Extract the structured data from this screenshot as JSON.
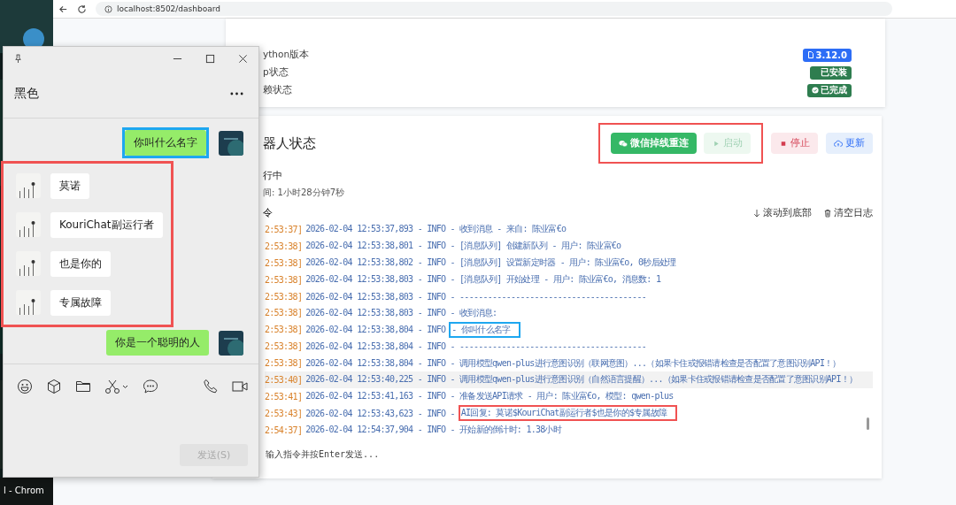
{
  "desktop": {
    "taskbar_label": "l - Chrom"
  },
  "browser": {
    "address": "localhost:8502/dashboard"
  },
  "env_card": {
    "rows": [
      {
        "label": "ython版本",
        "badge": "3.12.0",
        "kind": "version"
      },
      {
        "label": "p状态",
        "badge": "已安装",
        "kind": "installed"
      },
      {
        "label": "赖状态",
        "badge": "已完成",
        "kind": "done"
      }
    ]
  },
  "bot_card": {
    "title": "器人状态",
    "status": "行中",
    "uptime": "间: 1小时28分钟7秒",
    "button_groups": [
      {
        "annotation": {
          "color": "#f05252"
        },
        "buttons": [
          {
            "label": "微信掉线重连",
            "kind": "reconnect",
            "disabled": false
          },
          {
            "label": "启动",
            "kind": "start",
            "disabled": true
          }
        ]
      },
      {
        "buttons": [
          {
            "label": "停止",
            "kind": "stop",
            "disabled": false
          },
          {
            "label": "更新",
            "kind": "update",
            "disabled": false
          }
        ]
      }
    ],
    "log_title": "令",
    "log_actions": [
      {
        "label": "滚动到底部",
        "kind": "scroll"
      },
      {
        "label": "清空日志",
        "kind": "clear"
      }
    ],
    "log_lines": [
      {
        "time": "2:53:37]",
        "text": "2026-02-04 12:53:37,893 - INFO - 收到消息 - 来自: 陈业富€o",
        "hovered": false
      },
      {
        "time": "2:53:38]",
        "text": "2026-02-04 12:53:38,801 - INFO - [消息队列] 创建新队列 - 用户: 陈业富€o",
        "hovered": false
      },
      {
        "time": "2:53:38]",
        "text": "2026-02-04 12:53:38,802 - INFO - [消息队列] 设置新定时器 - 用户: 陈业富€o, 0秒后处理",
        "hovered": false
      },
      {
        "time": "2:53:38]",
        "text": "2026-02-04 12:53:38,803 - INFO - [消息队列] 开始处理 - 用户: 陈业富€o, 消息数: 1",
        "hovered": false
      },
      {
        "time": "2:53:38]",
        "text": "2026-02-04 12:53:38,803 - INFO - ----------------------------------------",
        "hovered": false
      },
      {
        "time": "2:53:38]",
        "text": "2026-02-04 12:53:38,803 - INFO - 收到消息:",
        "hovered": false
      },
      {
        "time": "2:53:38]",
        "text": "2026-02-04 12:53:38,804 - INFO",
        "note": {
          "text": "- 你叫什么名字",
          "color": "#1ea7f0"
        },
        "hovered": false
      },
      {
        "time": "2:53:38]",
        "text": "2026-02-04 12:53:38,804 - INFO - ----------------------------------------",
        "hovered": false
      },
      {
        "time": "2:53:38]",
        "text": "2026-02-04 12:53:38,804 - INFO - 调用模型qwen-plus进行意图识别（联网意图）...（如果卡住或报错请检查是否配置了意图识别API！）",
        "hovered": false
      },
      {
        "time": "2:53:40]",
        "text": "2026-02-04 12:53:40,225 - INFO - 调用模型qwen-plus进行意图识别（自然语言提醒）...（如果卡住或报错请检查是否配置了意图识别API！）",
        "hovered": true
      },
      {
        "time": "2:53:41]",
        "text": "2026-02-04 12:53:41,163 - INFO - 准备发送API请求 - 用户: 陈业富€o, 模型: qwen-plus",
        "hovered": false
      },
      {
        "time": "2:53:43]",
        "text": "2026-02-04 12:53:43,623 - INFO -",
        "note": {
          "text": "AI回复: 莫诺$KouriChat副运行者$也是你的$专属故障",
          "color": "#f05252"
        },
        "hovered": false
      },
      {
        "time": "2:54:37]",
        "text": "2026-02-04 12:54:37,904 - INFO - 开始新的倒计时: 1.38小时",
        "hovered": false
      }
    ],
    "command_placeholder": "输入指令并按Enter发送..."
  },
  "chat": {
    "title": "黑色",
    "items": [
      {
        "kind": "sent",
        "text": "你叫什么名字",
        "annotation": {
          "color": "#1ea7f0"
        }
      },
      {
        "kind": "group",
        "annotation": {
          "color": "#f05252"
        },
        "messages": [
          {
            "kind": "received",
            "text": "莫诺"
          },
          {
            "kind": "received",
            "text": "KouriChat副运行者"
          },
          {
            "kind": "received",
            "text": "也是你的"
          },
          {
            "kind": "received",
            "text": "专属故障"
          }
        ]
      },
      {
        "kind": "sent",
        "text": "你是一个聪明的人"
      }
    ],
    "send_label": "发送(S)",
    "send_disabled": true
  }
}
